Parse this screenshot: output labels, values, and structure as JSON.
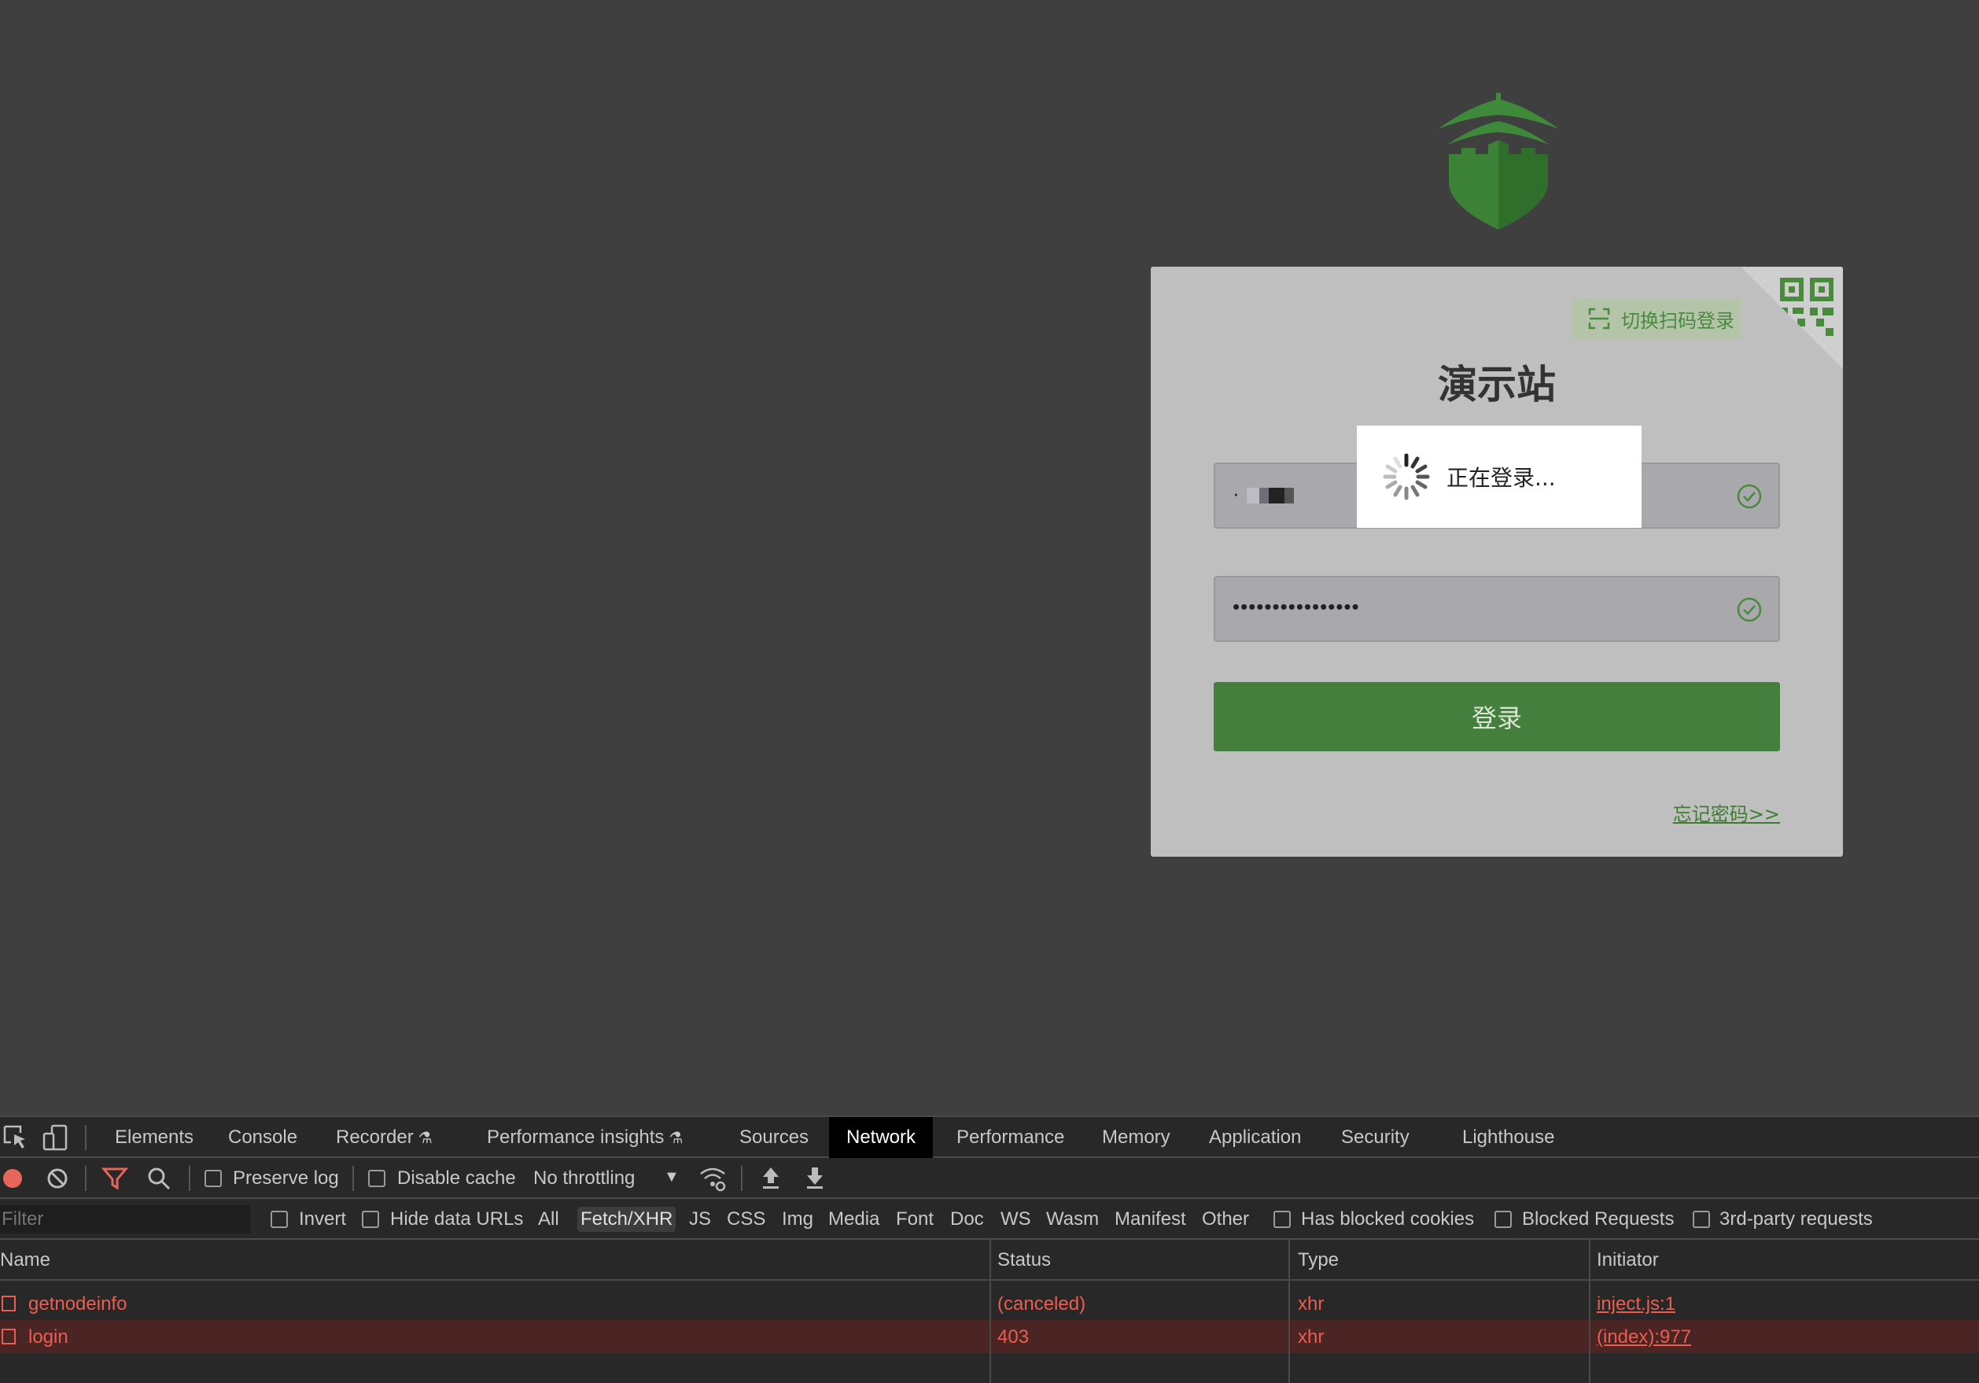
{
  "login": {
    "qr_switch_label": "切换扫码登录",
    "title": "演示站",
    "username_value": "·",
    "password_value": "••••••••••••••••",
    "submit_label": "登录",
    "forgot_link": "忘记密码>>",
    "loading_message": "正在登录...",
    "colors": {
      "brand_green": "#457f3d",
      "card_bg": "#bfbfbf",
      "page_bg": "#3f3f3f"
    }
  },
  "devtools": {
    "tabs": [
      {
        "label": "Elements"
      },
      {
        "label": "Console"
      },
      {
        "label": "Recorder"
      },
      {
        "label": "Performance insights"
      },
      {
        "label": "Sources"
      },
      {
        "label": "Network"
      },
      {
        "label": "Performance"
      },
      {
        "label": "Memory"
      },
      {
        "label": "Application"
      },
      {
        "label": "Security"
      },
      {
        "label": "Lighthouse"
      }
    ],
    "active_tab": "Network",
    "toolbar": {
      "preserve_log": "Preserve log",
      "disable_cache": "Disable cache",
      "throttling": "No throttling"
    },
    "filterbar": {
      "filter_placeholder": "Filter",
      "invert": "Invert",
      "hide_data_urls": "Hide data URLs",
      "types": [
        "All",
        "Fetch/XHR",
        "JS",
        "CSS",
        "Img",
        "Media",
        "Font",
        "Doc",
        "WS",
        "Wasm",
        "Manifest",
        "Other"
      ],
      "active_type": "Fetch/XHR",
      "has_blocked_cookies": "Has blocked cookies",
      "blocked_requests": "Blocked Requests",
      "third_party": "3rd-party requests"
    },
    "table": {
      "columns": [
        "Name",
        "Status",
        "Type",
        "Initiator"
      ],
      "rows": [
        {
          "name": "getnodeinfo",
          "status": "(canceled)",
          "type": "xhr",
          "initiator": "inject.js:1"
        },
        {
          "name": "login",
          "status": "403",
          "type": "xhr",
          "initiator": "(index):977"
        }
      ]
    },
    "colors": {
      "error_red": "#ee5c4f",
      "panel_bg": "#282828",
      "selected_row": "#4a2523"
    }
  }
}
